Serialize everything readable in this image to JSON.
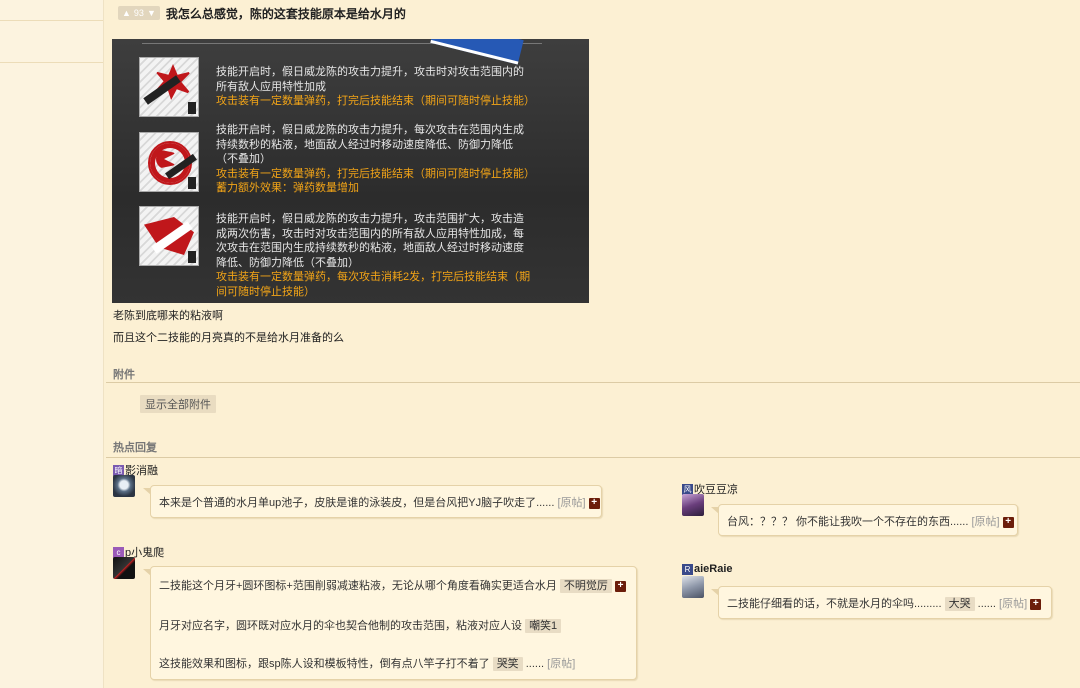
{
  "post": {
    "vote_count": "93",
    "title": "我怎么总感觉，陈的这套技能原本是给水月的"
  },
  "skills": [
    {
      "icon": "skill-1-icon",
      "lines": [
        "技能开启时，假日威龙陈的攻击力提升，攻击时对攻击范围内的",
        "所有敌人应用特性加成"
      ],
      "orange": [
        "攻击装有一定数量弹药，打完后技能结束（期间可随时停止技能）"
      ]
    },
    {
      "icon": "skill-2-icon",
      "lines": [
        "技能开启时，假日威龙陈的攻击力提升，每次攻击在范围内生成",
        "持续数秒的粘液，地面敌人经过时移动速度降低、防御力降低",
        "（不叠加）"
      ],
      "orange": [
        "攻击装有一定数量弹药，打完后技能结束（期间可随时停止技能）",
        "蓄力额外效果：弹药数量增加"
      ]
    },
    {
      "icon": "skill-3-icon",
      "lines": [
        "技能开启时，假日威龙陈的攻击力提升，攻击范围扩大，攻击造",
        "成两次伤害，攻击时对攻击范围内的所有敌人应用特性加成，每",
        "次攻击在范围内生成持续数秒的粘液，地面敌人经过时移动速度",
        "降低、防御力降低（不叠加）"
      ],
      "orange": [
        "攻击装有一定数量弹药，每次攻击消耗2发，打完后技能结束（期",
        "间可随时停止技能）"
      ]
    }
  ],
  "body": {
    "line1": "老陈到底哪来的粘液啊",
    "line2": "而且这个二技能的月亮真的不是给水月准备的么"
  },
  "attachments": {
    "heading": "附件",
    "show_all": "显示全部附件"
  },
  "hot": {
    "heading": "热点回复",
    "orig": "[原帖]",
    "plus": "+",
    "replies": {
      "r1": {
        "badge": "暗",
        "user": "影消融",
        "text": "本来是个普通的水月单up池子，皮肤是谁的泳装皮，但是台风把YJ脑子吹走了......"
      },
      "r2": {
        "badge": "风",
        "user": "吹豆豆凉",
        "text": "台风：？？？ 你不能让我吹一个不存在的东西......"
      },
      "r3": {
        "badge": "c",
        "user": "p小鬼爬",
        "l1": "二技能这个月牙+圆环图标+范围削弱减速粘液，无论从哪个角度看确实更适合水月",
        "tag1": "不明觉厉",
        "l2": "月牙对应名字，圆环既对应水月的伞也契合他制的攻击范围，粘液对应人设",
        "tag2": "嘲笑1",
        "l3": "这技能效果和图标，跟sp陈人设和模板特性，倒有点八竿子打不着了",
        "tag3": "哭笑",
        "tail3": "......"
      },
      "r4": {
        "badge": "R",
        "user": "aieRaie",
        "text": "二技能仔细看的话，不就是水月的伞吗.........",
        "tag": "大哭",
        "tail": "......"
      }
    }
  },
  "colors": {
    "badge_purple": "#7a5ab0",
    "badge_blue": "#3a4a8a",
    "plus_bg": "#6b1d0a",
    "orange_text": "#f2a417"
  }
}
